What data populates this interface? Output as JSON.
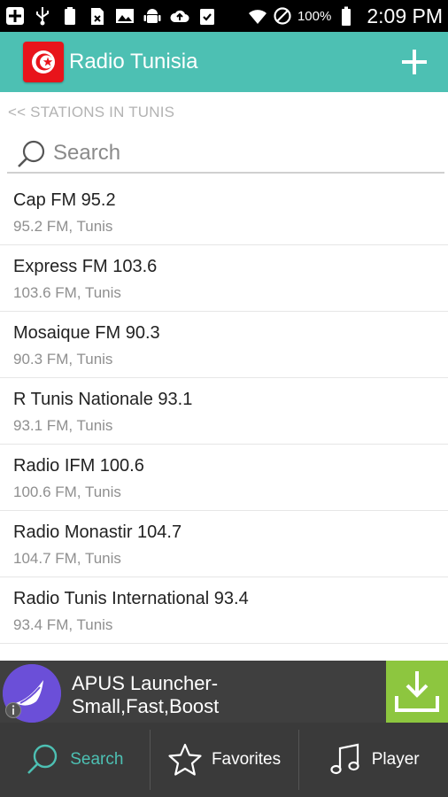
{
  "status_bar": {
    "battery_percent": "100%",
    "time": "2:09 PM",
    "icons": [
      "add-icon",
      "usb-icon",
      "battery-100-icon",
      "sim-icon",
      "image-icon",
      "android-icon",
      "cloud-upload-icon",
      "clipboard-check-icon",
      "wifi-icon",
      "do-not-disturb-icon",
      "battery-icon"
    ]
  },
  "app_bar": {
    "title": "Radio Tunisia",
    "logo": "tunisia-flag-icon",
    "action": "add-icon"
  },
  "breadcrumb": "<< STATIONS IN TUNIS",
  "search": {
    "placeholder": "Search",
    "value": ""
  },
  "stations": [
    {
      "name": "Cap FM 95.2",
      "detail": "95.2 FM, Tunis"
    },
    {
      "name": "Express FM 103.6",
      "detail": "103.6 FM, Tunis"
    },
    {
      "name": "Mosaique FM 90.3",
      "detail": "90.3 FM, Tunis"
    },
    {
      "name": "R Tunis Nationale 93.1",
      "detail": "93.1 FM, Tunis"
    },
    {
      "name": "Radio IFM 100.6",
      "detail": "100.6 FM, Tunis"
    },
    {
      "name": "Radio Monastir 104.7",
      "detail": "104.7 FM, Tunis"
    },
    {
      "name": "Radio Tunis International 93.4",
      "detail": "93.4 FM, Tunis"
    }
  ],
  "ad": {
    "text_line1": "APUS Launcher-",
    "text_line2": "Small,Fast,Boost",
    "download_icon": "download-icon",
    "info_icon": "info-icon"
  },
  "bottom_nav": {
    "items": [
      {
        "label": "Search",
        "icon": "search-icon",
        "active": true
      },
      {
        "label": "Favorites",
        "icon": "star-icon",
        "active": false
      },
      {
        "label": "Player",
        "icon": "music-note-icon",
        "active": false
      }
    ]
  },
  "colors": {
    "accent": "#4dc0b3",
    "status_bar_bg": "#000000",
    "bottom_nav_bg": "#3a3a3a",
    "ad_bg": "#3f3f3f",
    "ad_download_bg": "#8dc63f",
    "logo_red": "#e8141b"
  }
}
